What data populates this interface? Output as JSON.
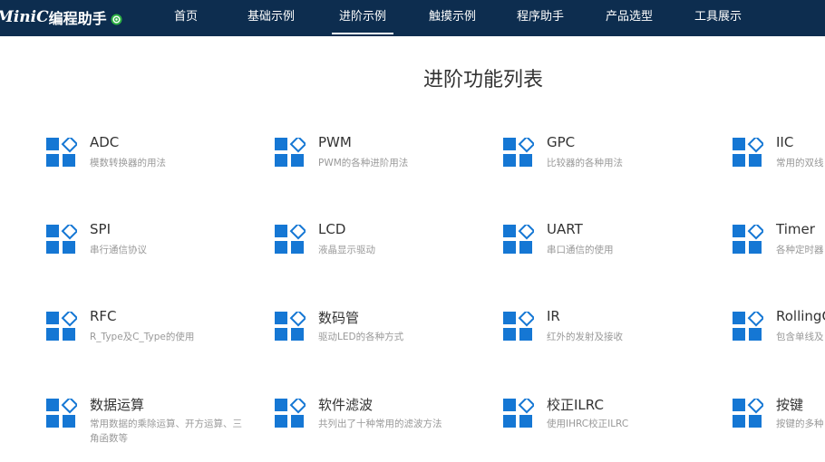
{
  "header": {
    "brand_en": "MiniC",
    "brand_cn": "编程助手",
    "logo_icon": "gear-logo-icon",
    "nav": [
      {
        "label": "首页",
        "active": false
      },
      {
        "label": "基础示例",
        "active": false
      },
      {
        "label": "进阶示例",
        "active": true
      },
      {
        "label": "触摸示例",
        "active": false
      },
      {
        "label": "程序助手",
        "active": false
      },
      {
        "label": "产品选型",
        "active": false
      },
      {
        "label": "工具展示",
        "active": false
      }
    ]
  },
  "main": {
    "title": "进阶功能列表",
    "items": [
      {
        "title": "ADC",
        "desc": "模数转换器的用法"
      },
      {
        "title": "PWM",
        "desc": "PWM的各种进阶用法"
      },
      {
        "title": "GPC",
        "desc": "比较器的各种用法"
      },
      {
        "title": "IIC",
        "desc": "常用的双线"
      },
      {
        "title": "SPI",
        "desc": "串行通信协议"
      },
      {
        "title": "LCD",
        "desc": "液晶显示驱动"
      },
      {
        "title": "UART",
        "desc": "串口通信的使用"
      },
      {
        "title": "Timer",
        "desc": "各种定时器"
      },
      {
        "title": "RFC",
        "desc": "R_Type及C_Type的使用"
      },
      {
        "title": "数码管",
        "desc": "驱动LED的各种方式"
      },
      {
        "title": "IR",
        "desc": "红外的发射及接收"
      },
      {
        "title": "RollingC",
        "desc": "包含单线及"
      },
      {
        "title": "数据运算",
        "desc": "常用数据的乘除运算、开方运算、三角函数等"
      },
      {
        "title": "软件滤波",
        "desc": "共列出了十种常用的滤波方法"
      },
      {
        "title": "校正ILRC",
        "desc": "使用IHRC校正ILRC"
      },
      {
        "title": "按键",
        "desc": "按键的多种"
      }
    ]
  },
  "colors": {
    "header_bg": "#0d2d4f",
    "icon_blue": "#1577d4",
    "title_text": "#333333",
    "desc_text": "#999999",
    "logo_green": "#2fb344"
  }
}
